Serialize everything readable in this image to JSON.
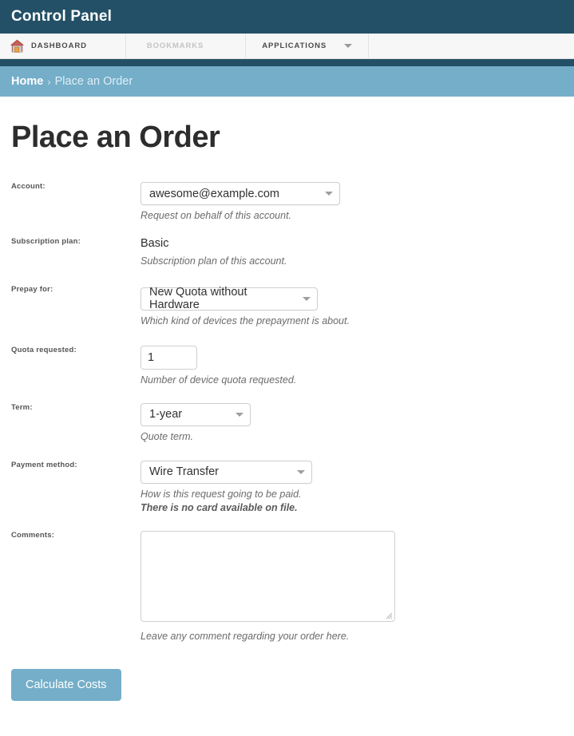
{
  "app": {
    "title": "Control Panel",
    "brand_dark": "#235066",
    "brand_light": "#74aec9"
  },
  "nav": {
    "items": [
      {
        "label": "DASHBOARD",
        "icon": "home-icon",
        "disabled": false,
        "has_caret": false
      },
      {
        "label": "BOOKMARKS",
        "icon": "",
        "disabled": true,
        "has_caret": false
      },
      {
        "label": "APPLICATIONS",
        "icon": "",
        "disabled": false,
        "has_caret": true
      }
    ]
  },
  "breadcrumb": {
    "home": "Home",
    "separator": "›",
    "current": "Place an Order"
  },
  "page": {
    "title": "Place an Order"
  },
  "form": {
    "account": {
      "label": "Account:",
      "value": "awesome@example.com",
      "help": "Request on behalf of this account."
    },
    "subscription_plan": {
      "label": "Subscription plan:",
      "value": "Basic",
      "help": "Subscription plan of this account."
    },
    "prepay_for": {
      "label": "Prepay for:",
      "value": "New Quota without Hardware",
      "help": "Which kind of devices the prepayment is about."
    },
    "quota_requested": {
      "label": "Quota requested:",
      "value": "1",
      "placeholder": "",
      "help": "Number of device quota requested."
    },
    "term": {
      "label": "Term:",
      "value": "1-year",
      "help": "Quote term."
    },
    "payment_method": {
      "label": "Payment method:",
      "value": "Wire Transfer",
      "help": "How is this request going to be paid.",
      "help_strong": "There is no card available on file."
    },
    "comments": {
      "label": "Comments:",
      "value": "",
      "placeholder": "",
      "help": "Leave any comment regarding your order here."
    }
  },
  "actions": {
    "calculate_costs": "Calculate Costs"
  }
}
